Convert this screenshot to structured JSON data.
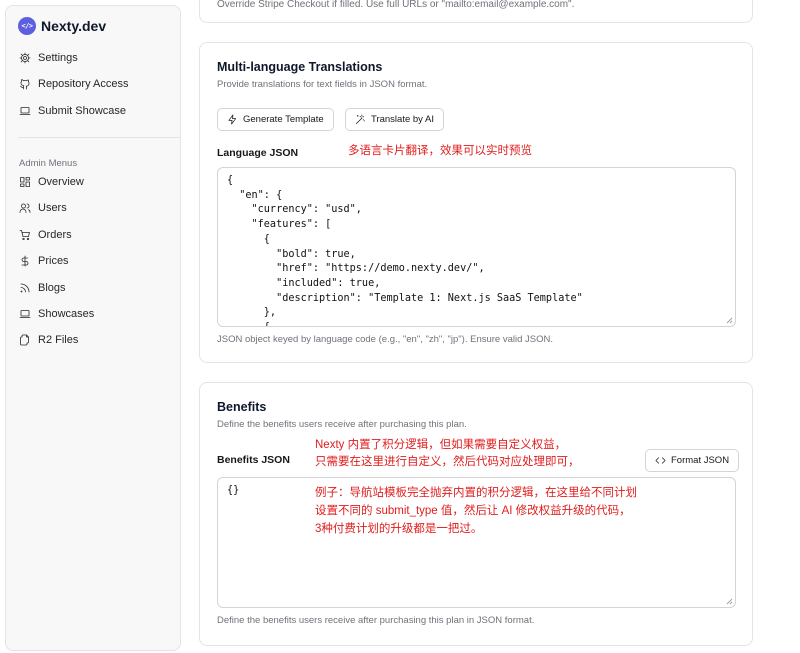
{
  "brand": {
    "logo_text": "</>",
    "name": "Nexty.dev"
  },
  "sidebar": {
    "top_items": [
      {
        "label": "Settings",
        "icon": "gear-icon"
      },
      {
        "label": "Repository Access",
        "icon": "github-icon"
      },
      {
        "label": "Submit Showcase",
        "icon": "laptop-icon"
      }
    ],
    "group_label": "Admin Menus",
    "admin_items": [
      {
        "label": "Overview",
        "icon": "grid-icon"
      },
      {
        "label": "Users",
        "icon": "users-icon"
      },
      {
        "label": "Orders",
        "icon": "cart-icon"
      },
      {
        "label": "Prices",
        "icon": "dollar-icon"
      },
      {
        "label": "Blogs",
        "icon": "rss-icon"
      },
      {
        "label": "Showcases",
        "icon": "laptop-icon"
      },
      {
        "label": "R2 Files",
        "icon": "files-icon"
      }
    ]
  },
  "top_card": {
    "faint_text": "Override Stripe Checkout if filled. Use full URLs or \"mailto:email@example.com\"."
  },
  "translations": {
    "title": "Multi-language Translations",
    "description": "Provide translations for text fields in JSON format.",
    "generate_button": "Generate Template",
    "translate_button": "Translate by AI",
    "field_label": "Language JSON",
    "annotation": "多语言卡片翻译，效果可以实时预览",
    "json_value": "{\n  \"en\": {\n    \"currency\": \"usd\",\n    \"features\": [\n      {\n        \"bold\": true,\n        \"href\": \"https://demo.nexty.dev/\",\n        \"included\": true,\n        \"description\": \"Template 1: Next.js SaaS Template\"\n      },\n      {",
    "help_text": "JSON object keyed by language code (e.g., \"en\", \"zh\", \"jp\"). Ensure valid JSON."
  },
  "benefits": {
    "title": "Benefits",
    "description": "Define the benefits users receive after purchasing this plan.",
    "field_label": "Benefits JSON",
    "format_button": "Format JSON",
    "annotation_line1": "Nexty 内置了积分逻辑，但如果需要自定义权益，",
    "annotation_line2": "只需要在这里进行自定义，然后代码对应处理即可，",
    "example_line1": "例子：导航站模板完全抛弃内置的积分逻辑，在这里给不同计划",
    "example_line2": "设置不同的 submit_type 值，然后让 AI 修改权益升级的代码，",
    "example_line3": "3种付费计划的升级都是一把过。",
    "json_value": "{}",
    "help_text": "Define the benefits users receive after purchasing this plan in JSON format."
  },
  "colors": {
    "accent": "#5b5fe0",
    "annotation": "#e11d1d",
    "border": "#e4e4e7",
    "sidebar_bg": "#f8f8f9"
  }
}
